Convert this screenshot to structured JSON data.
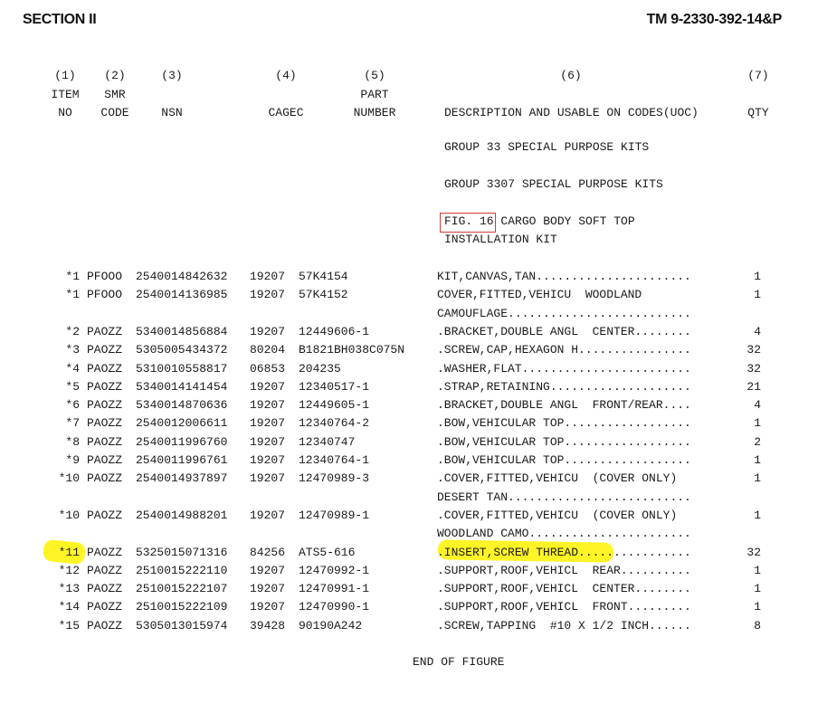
{
  "header": {
    "section": "SECTION II",
    "manual": "TM 9-2330-392-14&P"
  },
  "columns": [
    {
      "num": "(1)",
      "line1": "ITEM",
      "line2": "NO"
    },
    {
      "num": "(2)",
      "line1": "SMR",
      "line2": "CODE"
    },
    {
      "num": "(3)",
      "line1": "",
      "line2": "NSN"
    },
    {
      "num": "(4)",
      "line1": "",
      "line2": "CAGEC"
    },
    {
      "num": "(5)",
      "line1": "PART",
      "line2": "NUMBER"
    },
    {
      "num": "(6)",
      "line1": "",
      "line2": "DESCRIPTION AND USABLE ON CODES(UOC)"
    },
    {
      "num": "(7)",
      "line1": "",
      "line2": "QTY"
    }
  ],
  "groups": {
    "group1": "GROUP 33 SPECIAL PURPOSE KITS",
    "group2": "GROUP 3307 SPECIAL PURPOSE KITS",
    "fig_line1": "FIG. 16 CARGO BODY SOFT TOP",
    "fig_line2": "INSTALLATION KIT"
  },
  "rows": [
    {
      "item": "*1",
      "smr": "PFOOO",
      "nsn": "2540014842632",
      "cagec": "19207",
      "part": "57K4154",
      "desc": "KIT,CANVAS,TAN......................",
      "qty": "1"
    },
    {
      "item": "*1",
      "smr": "PFOOO",
      "nsn": "2540014136985",
      "cagec": "19207",
      "part": "57K4152",
      "desc": "COVER,FITTED,VEHICU  WOODLAND",
      "qty": "1"
    },
    {
      "item": "",
      "smr": "",
      "nsn": "",
      "cagec": "",
      "part": "",
      "desc": "CAMOUFLAGE..........................",
      "qty": ""
    },
    {
      "item": "*2",
      "smr": "PAOZZ",
      "nsn": "5340014856884",
      "cagec": "19207",
      "part": "12449606-1",
      "desc": ".BRACKET,DOUBLE ANGL  CENTER........",
      "qty": "4"
    },
    {
      "item": "*3",
      "smr": "PAOZZ",
      "nsn": "5305005434372",
      "cagec": "80204",
      "part": "B1821BH038C075N",
      "desc": ".SCREW,CAP,HEXAGON H................",
      "qty": "32"
    },
    {
      "item": "*4",
      "smr": "PAOZZ",
      "nsn": "5310010558817",
      "cagec": "06853",
      "part": "204235",
      "desc": ".WASHER,FLAT........................",
      "qty": "32"
    },
    {
      "item": "*5",
      "smr": "PAOZZ",
      "nsn": "5340014141454",
      "cagec": "19207",
      "part": "12340517-1",
      "desc": ".STRAP,RETAINING....................",
      "qty": "21"
    },
    {
      "item": "*6",
      "smr": "PAOZZ",
      "nsn": "5340014870636",
      "cagec": "19207",
      "part": "12449605-1",
      "desc": ".BRACKET,DOUBLE ANGL  FRONT/REAR....",
      "qty": "4"
    },
    {
      "item": "*7",
      "smr": "PAOZZ",
      "nsn": "2540012006611",
      "cagec": "19207",
      "part": "12340764-2",
      "desc": ".BOW,VEHICULAR TOP..................",
      "qty": "1"
    },
    {
      "item": "*8",
      "smr": "PAOZZ",
      "nsn": "2540011996760",
      "cagec": "19207",
      "part": "12340747",
      "desc": ".BOW,VEHICULAR TOP..................",
      "qty": "2"
    },
    {
      "item": "*9",
      "smr": "PAOZZ",
      "nsn": "2540011996761",
      "cagec": "19207",
      "part": "12340764-1",
      "desc": ".BOW,VEHICULAR TOP..................",
      "qty": "1"
    },
    {
      "item": "*10",
      "smr": "PAOZZ",
      "nsn": "2540014937897",
      "cagec": "19207",
      "part": "12470989-3",
      "desc": ".COVER,FITTED,VEHICU  (COVER ONLY)",
      "qty": "1"
    },
    {
      "item": "",
      "smr": "",
      "nsn": "",
      "cagec": "",
      "part": "",
      "desc": "DESERT TAN..........................",
      "qty": ""
    },
    {
      "item": "*10",
      "smr": "PAOZZ",
      "nsn": "2540014988201",
      "cagec": "19207",
      "part": "12470989-1",
      "desc": ".COVER,FITTED,VEHICU  (COVER ONLY)",
      "qty": "1"
    },
    {
      "item": "",
      "smr": "",
      "nsn": "",
      "cagec": "",
      "part": "",
      "desc": "WOODLAND CAMO.......................",
      "qty": ""
    },
    {
      "item": "*11",
      "smr": "PAOZZ",
      "nsn": "5325015071316",
      "cagec": "84256",
      "part": "ATS5-616",
      "desc": ".INSERT,SCREW THREAD................",
      "qty": "32"
    },
    {
      "item": "*12",
      "smr": "PAOZZ",
      "nsn": "2510015222110",
      "cagec": "19207",
      "part": "12470992-1",
      "desc": ".SUPPORT,ROOF,VEHICL  REAR..........",
      "qty": "1"
    },
    {
      "item": "*13",
      "smr": "PAOZZ",
      "nsn": "2510015222107",
      "cagec": "19207",
      "part": "12470991-1",
      "desc": ".SUPPORT,ROOF,VEHICL  CENTER........",
      "qty": "1"
    },
    {
      "item": "*14",
      "smr": "PAOZZ",
      "nsn": "2510015222109",
      "cagec": "19207",
      "part": "12470990-1",
      "desc": ".SUPPORT,ROOF,VEHICL  FRONT.........",
      "qty": "1"
    },
    {
      "item": "*15",
      "smr": "PAOZZ",
      "nsn": "5305013015974",
      "cagec": "39428",
      "part": "90190A242",
      "desc": ".SCREW,TAPPING  #10 X 1/2 INCH......",
      "qty": "8"
    }
  ],
  "footer": "END OF FIGURE"
}
